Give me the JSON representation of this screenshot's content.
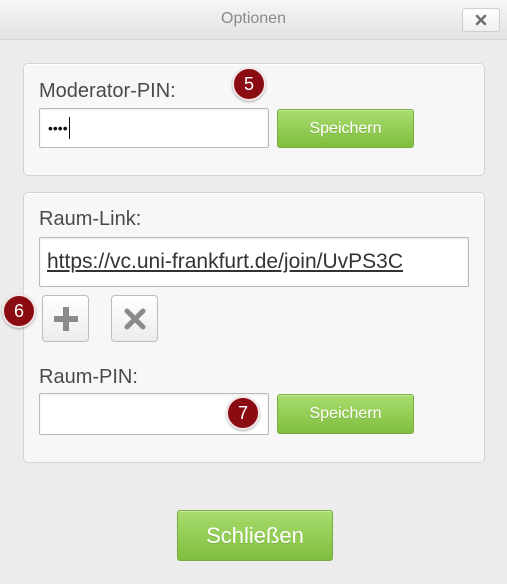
{
  "dialog": {
    "title": "Optionen",
    "close_icon": "close-icon"
  },
  "moderator": {
    "label": "Moderator-PIN:",
    "pin_value": "••••",
    "save_label": "Speichern"
  },
  "room": {
    "link_label": "Raum-Link:",
    "link_value": "https://vc.uni-frankfurt.de/join/UvPS3C",
    "add_icon": "plus-icon",
    "delete_icon": "close-icon",
    "pin_label": "Raum-PIN:",
    "pin_value": "",
    "save_label": "Speichern"
  },
  "footer": {
    "close_label": "Schließen"
  },
  "annotations": {
    "badge_5": "5",
    "badge_6": "6",
    "badge_7": "7"
  },
  "colors": {
    "accent_green": "#8cc84b",
    "badge_red": "#8b0b12"
  }
}
